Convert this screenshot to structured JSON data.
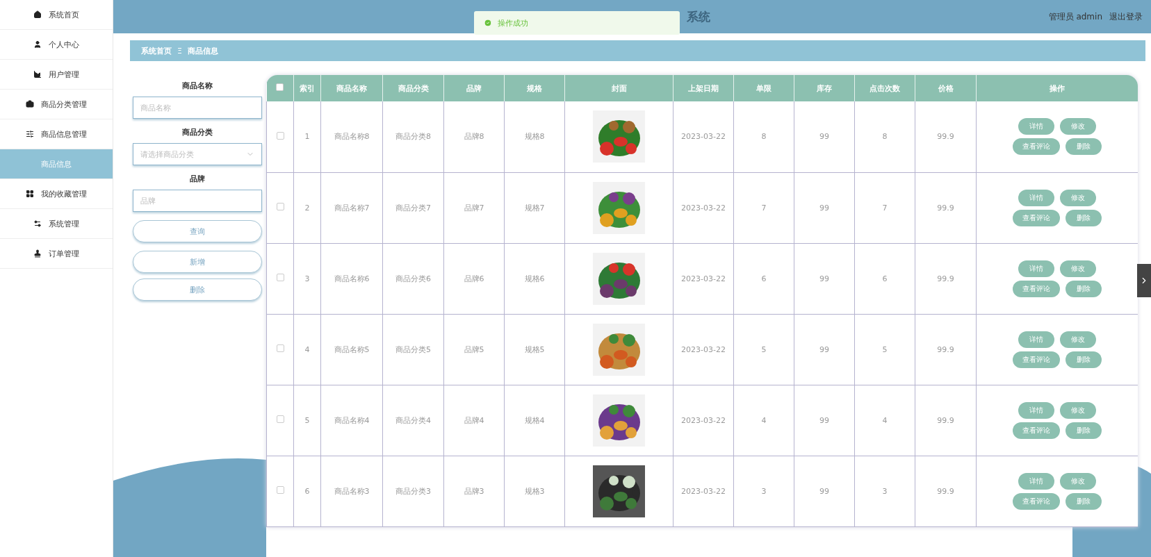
{
  "sidebar": {
    "items": [
      {
        "label": "系统首页",
        "kind": "menu",
        "selected": false
      },
      {
        "label": "个人中心",
        "kind": "menu",
        "selected": false
      },
      {
        "label": "用户管理",
        "kind": "menu",
        "selected": false
      },
      {
        "label": "商品分类管理",
        "kind": "menu",
        "selected": false
      },
      {
        "label": "商品信息管理",
        "kind": "menu",
        "selected": false
      },
      {
        "label": "商品信息",
        "kind": "submenu",
        "selected": true
      },
      {
        "label": "我的收藏管理",
        "kind": "menu",
        "selected": false
      },
      {
        "label": "系统管理",
        "kind": "menu",
        "selected": false
      },
      {
        "label": "订单管理",
        "kind": "menu",
        "selected": false
      }
    ]
  },
  "header": {
    "title": "系统",
    "user": "管理员 admin",
    "logout": "退出登录"
  },
  "toast": {
    "text": "操作成功"
  },
  "breadcrumb": [
    "系统首页",
    "商品信息"
  ],
  "breadcrumb_separator": "Ξ",
  "filters": [
    {
      "label": "商品名称",
      "kind": "input",
      "placeholder": "商品名称"
    },
    {
      "label": "商品分类",
      "kind": "select",
      "placeholder": "请选择商品分类"
    },
    {
      "label": "品牌",
      "kind": "input",
      "placeholder": "品牌"
    }
  ],
  "buttons": [
    "查询",
    "新增",
    "删除"
  ],
  "table": {
    "select_all_checked": false,
    "columns": [
      "索引",
      "商品名称",
      "商品分类",
      "品牌",
      "规格",
      "封面",
      "上架日期",
      "单限",
      "库存",
      "点击次数",
      "价格",
      "操作"
    ],
    "rows": [
      {
        "checked": false,
        "cells": [
          "1",
          "商品名称8",
          "商品分类8",
          "品牌8",
          "规格8",
          "",
          "2023-03-22",
          "8",
          "99",
          "8",
          "99.9"
        ],
        "actions": [
          "详情",
          "修改",
          "查看评论",
          "删除"
        ]
      },
      {
        "checked": false,
        "cells": [
          "2",
          "商品名称7",
          "商品分类7",
          "品牌7",
          "规格7",
          "",
          "2023-03-22",
          "7",
          "99",
          "7",
          "99.9"
        ],
        "actions": [
          "详情",
          "修改",
          "查看评论",
          "删除"
        ]
      },
      {
        "checked": false,
        "cells": [
          "3",
          "商品名称6",
          "商品分类6",
          "品牌6",
          "规格6",
          "",
          "2023-03-22",
          "6",
          "99",
          "6",
          "99.9"
        ],
        "actions": [
          "详情",
          "修改",
          "查看评论",
          "删除"
        ]
      },
      {
        "checked": false,
        "cells": [
          "4",
          "商品名称5",
          "商品分类5",
          "品牌5",
          "规格5",
          "",
          "2023-03-22",
          "5",
          "99",
          "5",
          "99.9"
        ],
        "actions": [
          "详情",
          "修改",
          "查看评论",
          "删除"
        ]
      },
      {
        "checked": false,
        "cells": [
          "5",
          "商品名称4",
          "商品分类4",
          "品牌4",
          "规格4",
          "",
          "2023-03-22",
          "4",
          "99",
          "4",
          "99.9"
        ],
        "actions": [
          "详情",
          "修改",
          "查看评论",
          "删除"
        ]
      },
      {
        "checked": false,
        "cells": [
          "6",
          "商品名称3",
          "商品分类3",
          "品牌3",
          "规格3",
          "",
          "2023-03-22",
          "3",
          "99",
          "3",
          "99.9"
        ],
        "actions": [
          "详情",
          "修改",
          "查看评论",
          "删除"
        ]
      }
    ]
  }
}
